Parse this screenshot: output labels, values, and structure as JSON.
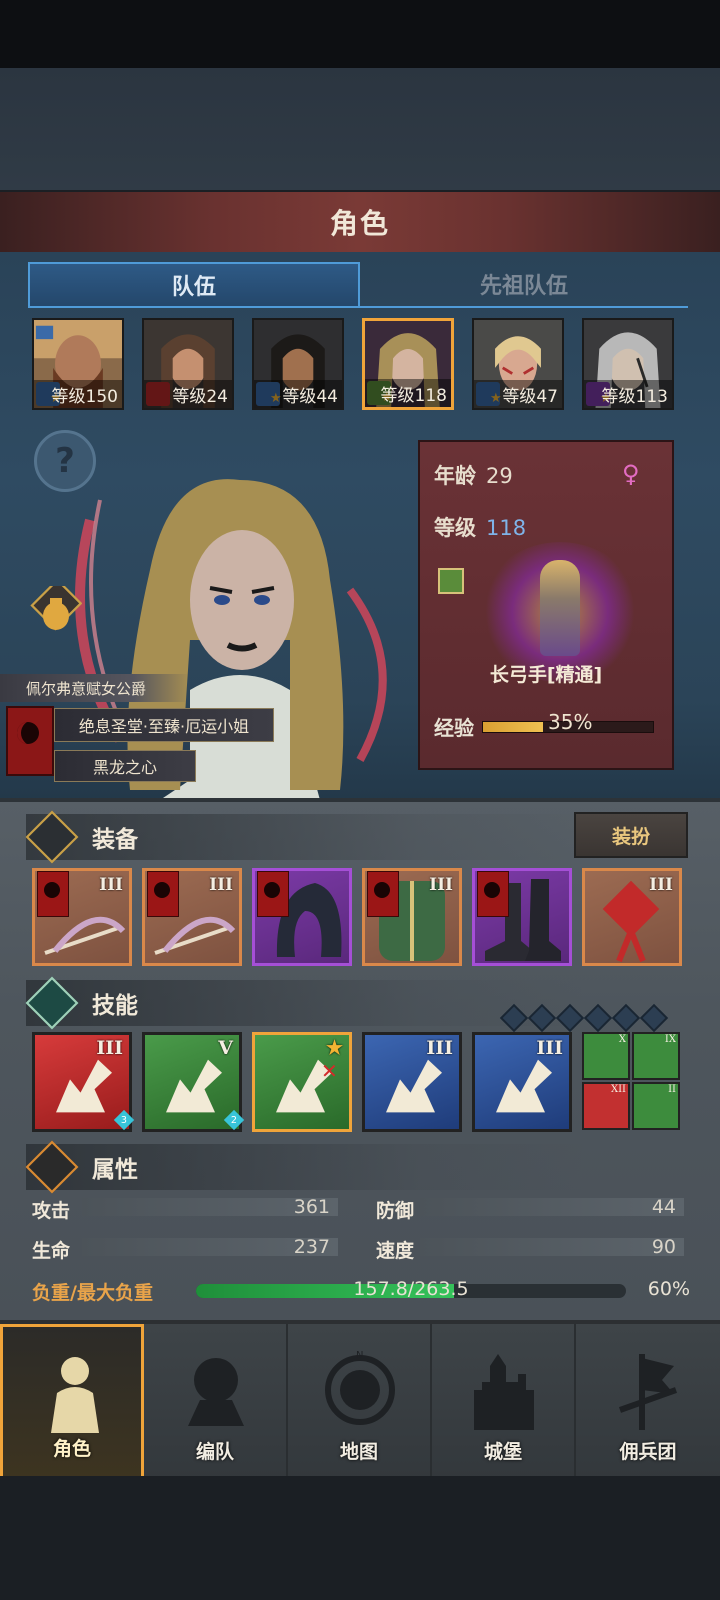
{
  "header": {
    "title": "角色"
  },
  "tabs": [
    {
      "label": "队伍",
      "active": true
    },
    {
      "label": "先祖队伍",
      "active": false
    }
  ],
  "heroes": [
    {
      "level_label": "等级150",
      "class_icon": "sword-icon",
      "selected": false
    },
    {
      "level_label": "等级24",
      "class_icon": "house-icon",
      "selected": false
    },
    {
      "level_label": "等级44",
      "class_icon": "sword-icon",
      "selected": false
    },
    {
      "level_label": "等级118",
      "class_icon": "bow-icon",
      "selected": true
    },
    {
      "level_label": "等级47",
      "class_icon": "sword-icon",
      "selected": false
    },
    {
      "level_label": "等级113",
      "class_icon": "staff-icon",
      "selected": false
    }
  ],
  "character": {
    "title_tag": "佩尔弗意赋女公爵",
    "epithet": "绝息圣堂·至臻·厄运小姐",
    "origin": "黑龙之心"
  },
  "info": {
    "age_label": "年龄",
    "age_value": "29",
    "level_label": "等级",
    "level_value": "118",
    "class_name": "长弓手[精通]",
    "exp_label": "经验",
    "exp_percent_text": "35%",
    "exp_fraction": 0.35,
    "gender_icon": "female-icon"
  },
  "equipment": {
    "title": "装备",
    "dress_button": "装扮",
    "slots": [
      {
        "tier": "III",
        "rarity": "orange",
        "item": "bow"
      },
      {
        "tier": "III",
        "rarity": "orange",
        "item": "bow"
      },
      {
        "tier": "",
        "rarity": "purple",
        "item": "hood"
      },
      {
        "tier": "III",
        "rarity": "orange",
        "item": "armor"
      },
      {
        "tier": "",
        "rarity": "purple",
        "item": "boots"
      },
      {
        "tier": "III",
        "rarity": "orange",
        "item": "charm"
      }
    ]
  },
  "skills": {
    "title": "技能",
    "items": [
      {
        "tier": "III",
        "color": "red",
        "badge": "3"
      },
      {
        "tier": "V",
        "color": "green",
        "badge": "2"
      },
      {
        "tier": "",
        "color": "green",
        "badge": ""
      },
      {
        "tier": "III",
        "color": "blue",
        "badge": ""
      },
      {
        "tier": "III",
        "color": "blue",
        "badge": ""
      }
    ],
    "mini": [
      {
        "tier": "X",
        "color": "green"
      },
      {
        "tier": "IX",
        "color": "green"
      },
      {
        "tier": "XII",
        "color": "red"
      },
      {
        "tier": "II",
        "color": "green"
      }
    ]
  },
  "attributes": {
    "title": "属性",
    "attack_label": "攻击",
    "attack_value": "361",
    "defense_label": "防御",
    "defense_value": "44",
    "hp_label": "生命",
    "hp_value": "237",
    "speed_label": "速度",
    "speed_value": "90",
    "load_label": "负重/最大负重",
    "load_value": "157.8/263.5",
    "load_percent_text": "60%",
    "load_fraction": 0.6
  },
  "nav": [
    {
      "label": "角色",
      "icon": "knight-icon",
      "active": true
    },
    {
      "label": "编队",
      "icon": "formation-icon",
      "active": false
    },
    {
      "label": "地图",
      "icon": "compass-icon",
      "active": false
    },
    {
      "label": "城堡",
      "icon": "castle-icon",
      "active": false
    },
    {
      "label": "佣兵团",
      "icon": "banner-icon",
      "active": false
    }
  ],
  "colors": {
    "accent": "#f0a43a",
    "tab_blue": "#4f9bd8",
    "load_green": "#35c25a"
  }
}
